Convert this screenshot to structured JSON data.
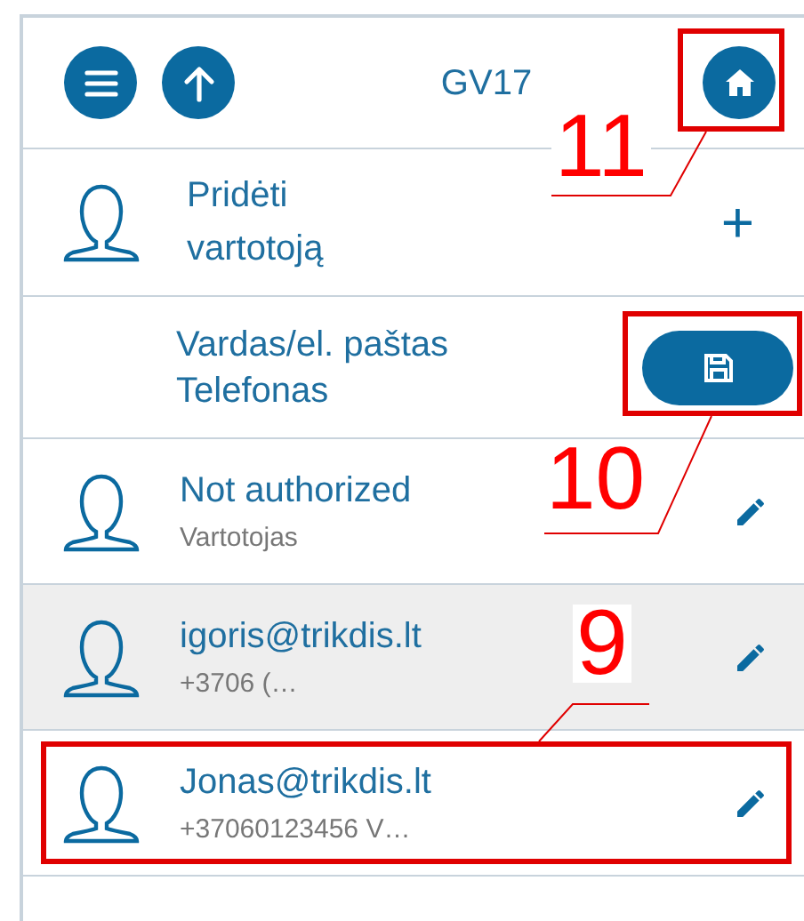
{
  "header": {
    "title": "GV17"
  },
  "add_user": {
    "label": "Pridėti vartotoją",
    "action": "+"
  },
  "form": {
    "name_label": "Vardas/el. paštas",
    "phone_label": "Telefonas"
  },
  "users": [
    {
      "name": "Not authorized",
      "detail": "Vartotojas",
      "highlighted": false
    },
    {
      "name": "igoris@trikdis.lt",
      "detail": "+3706 (…",
      "highlighted": true
    },
    {
      "name": "Jonas@trikdis.lt",
      "detail": "+37060123456 V…",
      "highlighted": false
    }
  ],
  "annotations": [
    {
      "label": "11"
    },
    {
      "label": "10"
    },
    {
      "label": "9"
    }
  ]
}
